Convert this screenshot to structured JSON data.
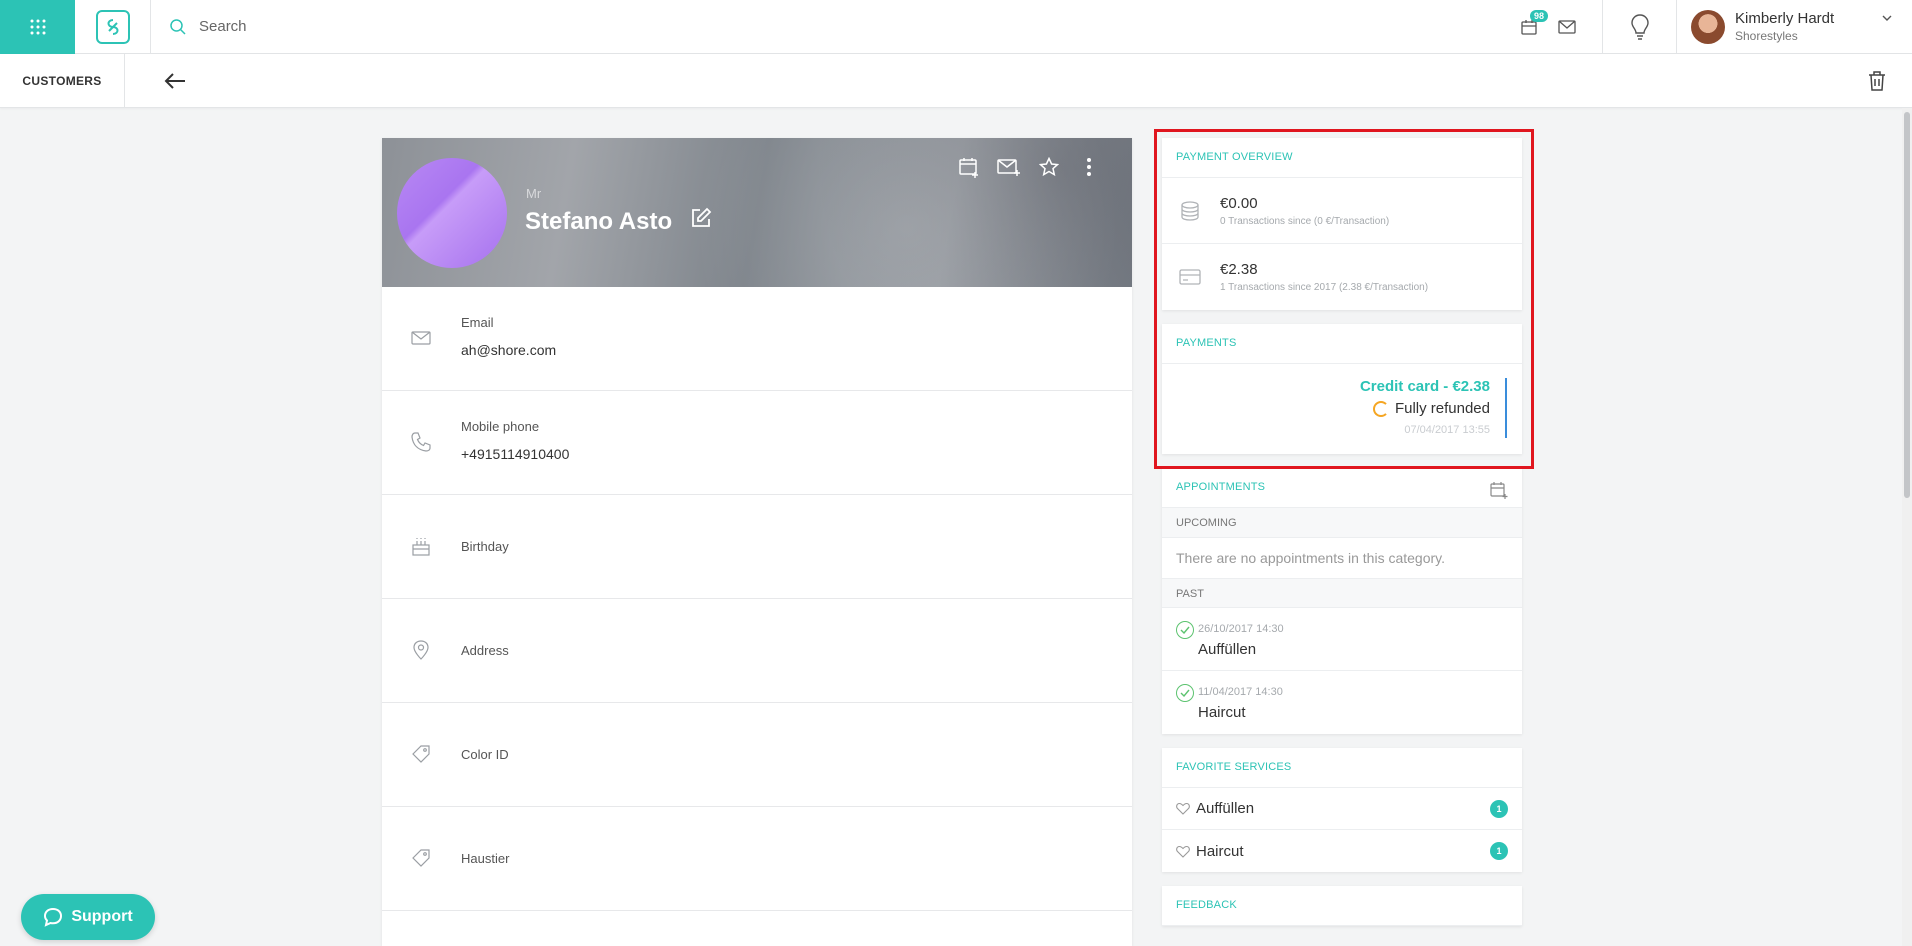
{
  "topbar": {
    "search_placeholder": "Search",
    "notifications_count": "98",
    "user": {
      "name": "Kimberly Hardt",
      "company": "Shorestyles"
    }
  },
  "subbar": {
    "breadcrumb": "CUSTOMERS"
  },
  "customer": {
    "salutation": "Mr",
    "name": "Stefano Asto",
    "fields": {
      "email_label": "Email",
      "email_value": "ah@shore.com",
      "phone_label": "Mobile phone",
      "phone_value": "+4915114910400",
      "birthday_label": "Birthday",
      "address_label": "Address",
      "color_label": "Color ID",
      "pet_label": "Haustier"
    }
  },
  "payment_overview": {
    "title": "PAYMENT OVERVIEW",
    "rows": [
      {
        "amount": "€0.00",
        "detail": "0 Transactions since (0 €/Transaction)"
      },
      {
        "amount": "€2.38",
        "detail": "1 Transactions since 2017 (2.38 €/Transaction)"
      }
    ]
  },
  "payments": {
    "title": "PAYMENTS",
    "entry": {
      "title": "Credit card - €2.38",
      "status": "Fully refunded",
      "date": "07/04/2017 13:55"
    }
  },
  "appointments": {
    "title": "APPOINTMENTS",
    "upcoming_label": "UPCOMING",
    "upcoming_empty": "There are no appointments in this category.",
    "past_label": "PAST",
    "past": [
      {
        "date": "26/10/2017 14:30",
        "name": "Auffüllen"
      },
      {
        "date": "11/04/2017 14:30",
        "name": "Haircut"
      }
    ]
  },
  "favorite_services": {
    "title": "FAVORITE SERVICES",
    "items": [
      {
        "name": "Auffüllen",
        "count": "1"
      },
      {
        "name": "Haircut",
        "count": "1"
      }
    ]
  },
  "feedback": {
    "title": "FEEDBACK"
  },
  "support": {
    "label": "Support"
  },
  "colors": {
    "accent": "#2cc3b5",
    "highlight": "#e0161f",
    "refund": "#f5a623",
    "done": "#5cc36f"
  }
}
